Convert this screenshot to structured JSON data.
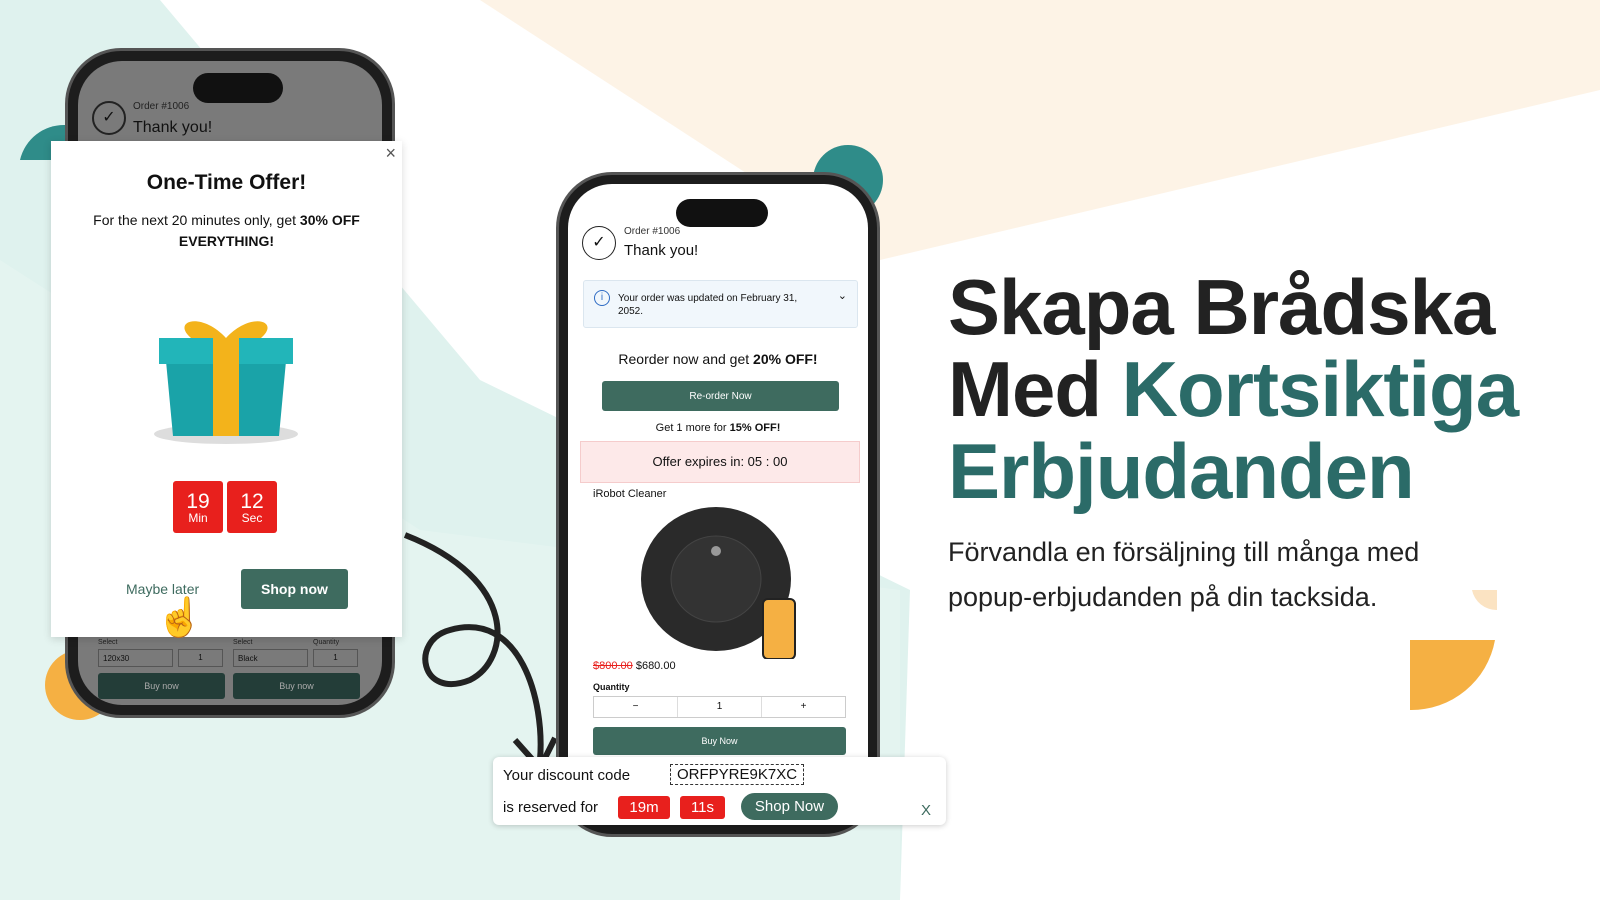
{
  "colors": {
    "accent": "#2b6b68",
    "button": "#3e6b5f",
    "red": "#e8201d",
    "orange": "#f5b043",
    "mint": "#dff2ee",
    "peach": "#fdf3e6"
  },
  "left_phone": {
    "order_label": "Order #1006",
    "thank_you": "Thank you!",
    "select_label": "Select",
    "quantity_label": "Quantity",
    "products": [
      {
        "select": "120x30",
        "qty": "1",
        "buy": "Buy now"
      },
      {
        "select": "Black",
        "qty": "1",
        "buy": "Buy now"
      }
    ]
  },
  "popup": {
    "close": "×",
    "title": "One-Time Offer!",
    "body_prefix": "For the next 20 minutes only, get ",
    "body_bold": "30% OFF EVERYTHING!",
    "timer": [
      {
        "value": "19",
        "unit": "Min"
      },
      {
        "value": "12",
        "unit": "Sec"
      }
    ],
    "maybe_later": "Maybe later",
    "shop_now": "Shop now"
  },
  "center_phone": {
    "order_label": "Order #1006",
    "thank_you": "Thank you!",
    "notice": "Your order was updated on February 31, 2052.",
    "reorder_prefix": "Reorder now and get ",
    "reorder_bold": "20% OFF!",
    "reorder_button": "Re-order Now",
    "get_more_prefix": "Get 1 more for ",
    "get_more_bold": "15% OFF!",
    "expires": "Offer expires in: 05 : 00",
    "product_name": "iRobot Cleaner",
    "old_price": "$800.00",
    "new_price": "$680.00",
    "quantity_label": "Quantity",
    "minus": "−",
    "qty": "1",
    "plus": "+",
    "buy_now": "Buy Now"
  },
  "discount_bar": {
    "label": "Your discount code",
    "code": "ORFPYRE9K7XC",
    "reserved": "is reserved for",
    "minutes": "19m",
    "seconds": "11s",
    "shop_now": "Shop Now",
    "close": "X"
  },
  "hero": {
    "line1": "Skapa Brådska",
    "line2_plain": "Med ",
    "line2_accent": "Kortsiktiga",
    "line3_accent": "Erbjudanden",
    "subtitle": "Förvandla en försäljning till många med popup-erbjudanden på din tacksida."
  }
}
